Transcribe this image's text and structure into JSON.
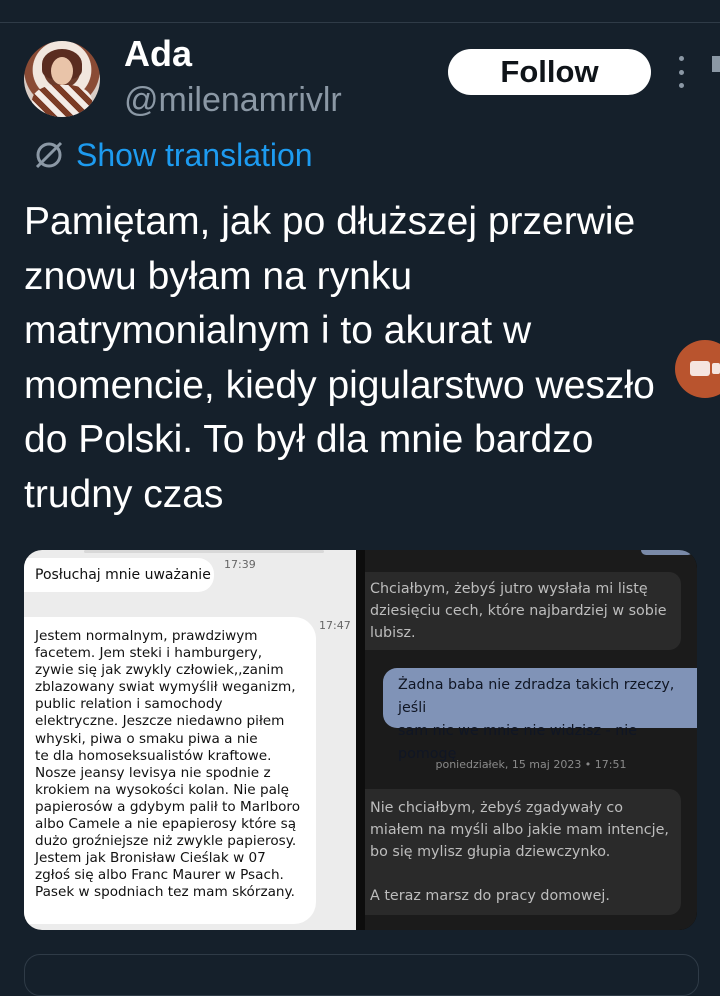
{
  "author": {
    "name": "Ada",
    "handle": "@milenamrivlr"
  },
  "follow_label": "Follow",
  "translate_label": "Show translation",
  "tweet_text": "Pamiętam, jak po dłuższej przerwie znowu byłam na rynku matrymonialnym i to akurat w momencie, kiedy pigularstwo weszło do Polski. To był dla mnie bardzo trudny czas",
  "left_screenshot": {
    "msg1": "Posłuchaj mnie uważanie",
    "time1": "17:39",
    "time2": "17:47",
    "msg2": "Jestem normalnym, prawdziwym\nfacetem. Jem steki i hamburgery,\nzywie się jak zwykly człowiek,,zanim\nzblazowany swiat wymyślił weganizm,\npublic relation i samochody\nelektryczne. Jeszcze niedawno piłem\nwhyski, piwa o smaku piwa a nie\nte dla homoseksualistów kraftowe.\nNosze jeansy levisya nie spodnie z\nkrokiem na wysokości kolan. Nie palę\npapierosów a gdybym palił to Marlboro\nalbo Camele a nie epapierosy które są\ndużo groźniejsze niż zwykle papierosy.\nJestem jak Bronisław Cieślak w 07\nzgłoś się albo Franc Maurer w Psach.\nPasek w spodniach tez mam skórzany."
  },
  "right_screenshot": {
    "msg1": "Chciałbym, żebyś jutro wysłała mi listę\ndziesięciu cech, które najbardziej w sobie\nlubisz.",
    "reply": "Żadna baba nie zdradza takich rzeczy, jeśli\nsam nic we mnie nie widzisz - nie pomogę",
    "date": "poniedziałek, 15 maj 2023 • 17:51",
    "msg2": "Nie chciałbym, żebyś zgadywały co\nmiałem na myśli albo jakie mam intencje,\nbo się mylisz głupia dziewczynko.\n\nA teraz marsz do pracy domowej."
  },
  "colors": {
    "background": "#15202b",
    "link": "#1d9bf0",
    "secondary_text": "#8b98a5",
    "reply_bubble": "#8093b7"
  }
}
